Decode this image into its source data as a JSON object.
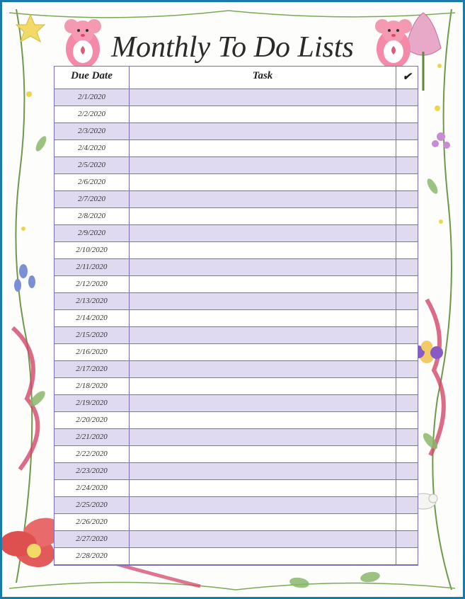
{
  "title": "Monthly To Do Lists",
  "headers": {
    "date": "Due Date",
    "task": "Task",
    "check": "✔"
  },
  "rows": [
    {
      "date": "2/1/2020",
      "task": "",
      "done": ""
    },
    {
      "date": "2/2/2020",
      "task": "",
      "done": ""
    },
    {
      "date": "2/3/2020",
      "task": "",
      "done": ""
    },
    {
      "date": "2/4/2020",
      "task": "",
      "done": ""
    },
    {
      "date": "2/5/2020",
      "task": "",
      "done": ""
    },
    {
      "date": "2/6/2020",
      "task": "",
      "done": ""
    },
    {
      "date": "2/7/2020",
      "task": "",
      "done": ""
    },
    {
      "date": "2/8/2020",
      "task": "",
      "done": ""
    },
    {
      "date": "2/9/2020",
      "task": "",
      "done": ""
    },
    {
      "date": "2/10/2020",
      "task": "",
      "done": ""
    },
    {
      "date": "2/11/2020",
      "task": "",
      "done": ""
    },
    {
      "date": "2/12/2020",
      "task": "",
      "done": ""
    },
    {
      "date": "2/13/2020",
      "task": "",
      "done": ""
    },
    {
      "date": "2/14/2020",
      "task": "",
      "done": ""
    },
    {
      "date": "2/15/2020",
      "task": "",
      "done": ""
    },
    {
      "date": "2/16/2020",
      "task": "",
      "done": ""
    },
    {
      "date": "2/17/2020",
      "task": "",
      "done": ""
    },
    {
      "date": "2/18/2020",
      "task": "",
      "done": ""
    },
    {
      "date": "2/19/2020",
      "task": "",
      "done": ""
    },
    {
      "date": "2/20/2020",
      "task": "",
      "done": ""
    },
    {
      "date": "2/21/2020",
      "task": "",
      "done": ""
    },
    {
      "date": "2/22/2020",
      "task": "",
      "done": ""
    },
    {
      "date": "2/23/2020",
      "task": "",
      "done": ""
    },
    {
      "date": "2/24/2020",
      "task": "",
      "done": ""
    },
    {
      "date": "2/25/2020",
      "task": "",
      "done": ""
    },
    {
      "date": "2/26/2020",
      "task": "",
      "done": ""
    },
    {
      "date": "2/27/2020",
      "task": "",
      "done": ""
    },
    {
      "date": "2/28/2020",
      "task": "",
      "done": ""
    }
  ]
}
